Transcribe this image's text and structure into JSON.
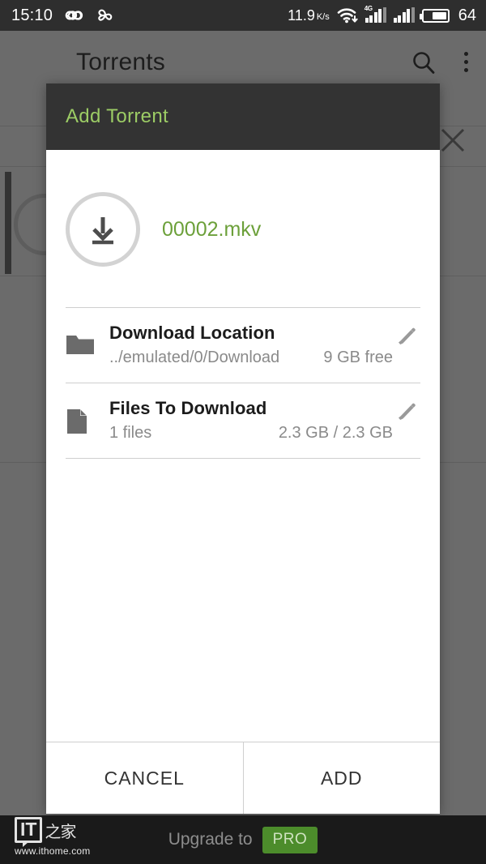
{
  "status_bar": {
    "clock": "15:10",
    "icons_left": [
      "infinity-icon",
      "clover-icon"
    ],
    "network_speed": "11.9",
    "network_speed_unit": "K/s",
    "network_speed_num": "11.9",
    "network_speed_k": "K",
    "network_speed_s": "s",
    "wifi_icon": "wifi-download-icon",
    "signal_label": "4G",
    "battery_level": "64",
    "battery_percent": 64
  },
  "app_bar": {
    "title": "Torrents",
    "menu_icon": "hamburger-menu-icon",
    "search_icon": "search-icon",
    "overflow_icon": "overflow-menu-icon"
  },
  "background": {
    "close_icon": "close-icon"
  },
  "dialog": {
    "title": "Add Torrent",
    "title_color": "#9ccc65",
    "torrent": {
      "icon": "download-arrow-icon",
      "name": "00002.mkv",
      "name_color": "#6ca03a"
    },
    "rows": [
      {
        "icon": "folder-icon",
        "title": "Download Location",
        "sub_left": "../emulated/0/Download",
        "sub_right": "9 GB free",
        "edit_icon": "pencil-edit-icon"
      },
      {
        "icon": "file-icon",
        "title": "Files To Download",
        "sub_left": "1 files",
        "sub_right": "2.3 GB / 2.3 GB",
        "edit_icon": "pencil-edit-icon"
      }
    ],
    "actions": {
      "cancel": "CANCEL",
      "add": "ADD"
    }
  },
  "bottom_bar": {
    "upgrade_text": "Upgrade to",
    "pro_badge": "PRO",
    "pro_badge_color": "#4c8c2b"
  },
  "watermark": {
    "logo_text": "IT",
    "logo_cn": "之家",
    "url": "www.ithome.com"
  }
}
